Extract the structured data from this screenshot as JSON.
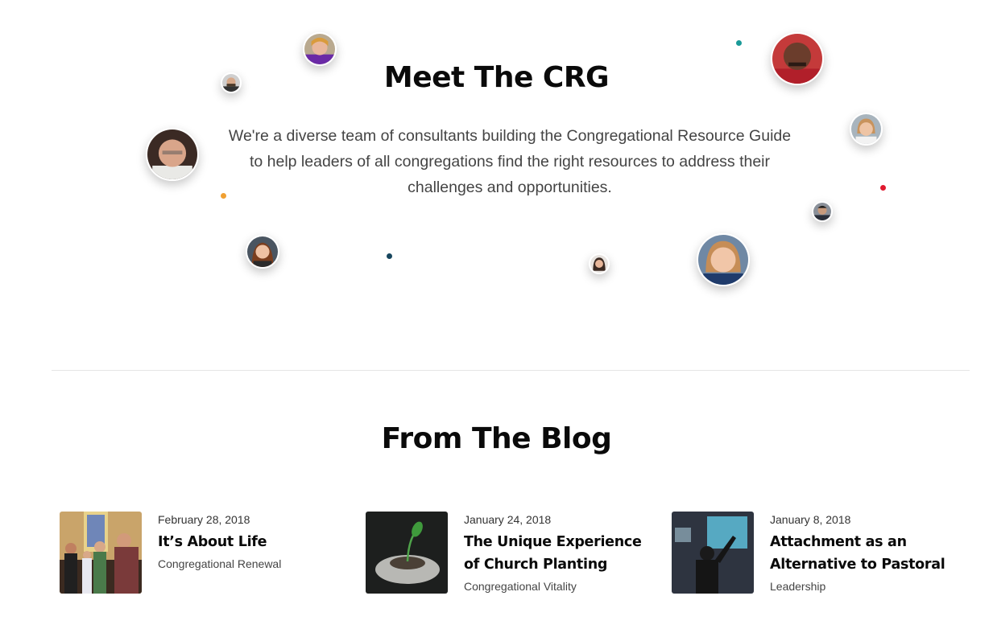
{
  "team": {
    "title": "Meet The CRG",
    "intro": "We're a diverse team of consultants building the Congregational Resource Guide to help leaders of all congregations find the right resources to address their challenges and opportunities."
  },
  "blog": {
    "title": "From The Blog",
    "posts": [
      {
        "date": "February 28, 2018",
        "title": "It’s About Life",
        "category": "Congregational Renewal"
      },
      {
        "date": "January 24, 2018",
        "title": "The Unique Experience of Church Planting",
        "category": "Congregational Vitality"
      },
      {
        "date": "January 8, 2018",
        "title": "Attachment as an Alternative to Pastoral",
        "category": "Leadership"
      }
    ]
  },
  "colors": {
    "dot_teal": "#1a9a98",
    "dot_orange": "#f0a032",
    "dot_red": "#e0192e",
    "dot_navy": "#17465e"
  }
}
